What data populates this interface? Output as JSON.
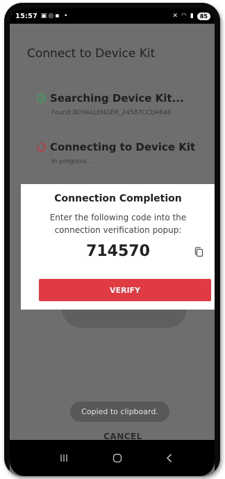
{
  "status_bar": {
    "time": "15:57",
    "battery": "85"
  },
  "app": {
    "title": "Connect to Device Kit"
  },
  "steps": [
    {
      "title": "Searching Device Kit...",
      "subtitle": "Found BCHALLENGER_24587CCDA646",
      "state": "done",
      "icon": "check-circle-icon",
      "color": "#3fa35a"
    },
    {
      "title": "Connecting to Device Kit",
      "subtitle": "In progress...",
      "state": "loading",
      "icon": "spinner-icon",
      "color": "#c8323a"
    }
  ],
  "dialog": {
    "title": "Connection Completion",
    "message": "Enter the following code into the connection verification popup:",
    "code": "714570",
    "verify_label": "VERIFY"
  },
  "toast": {
    "text": "Copied to clipboard."
  },
  "cancel_label": "CANCEL",
  "colors": {
    "accent": "#e03a43",
    "overlay": "#6e6e6e",
    "success": "#3fa35a"
  }
}
